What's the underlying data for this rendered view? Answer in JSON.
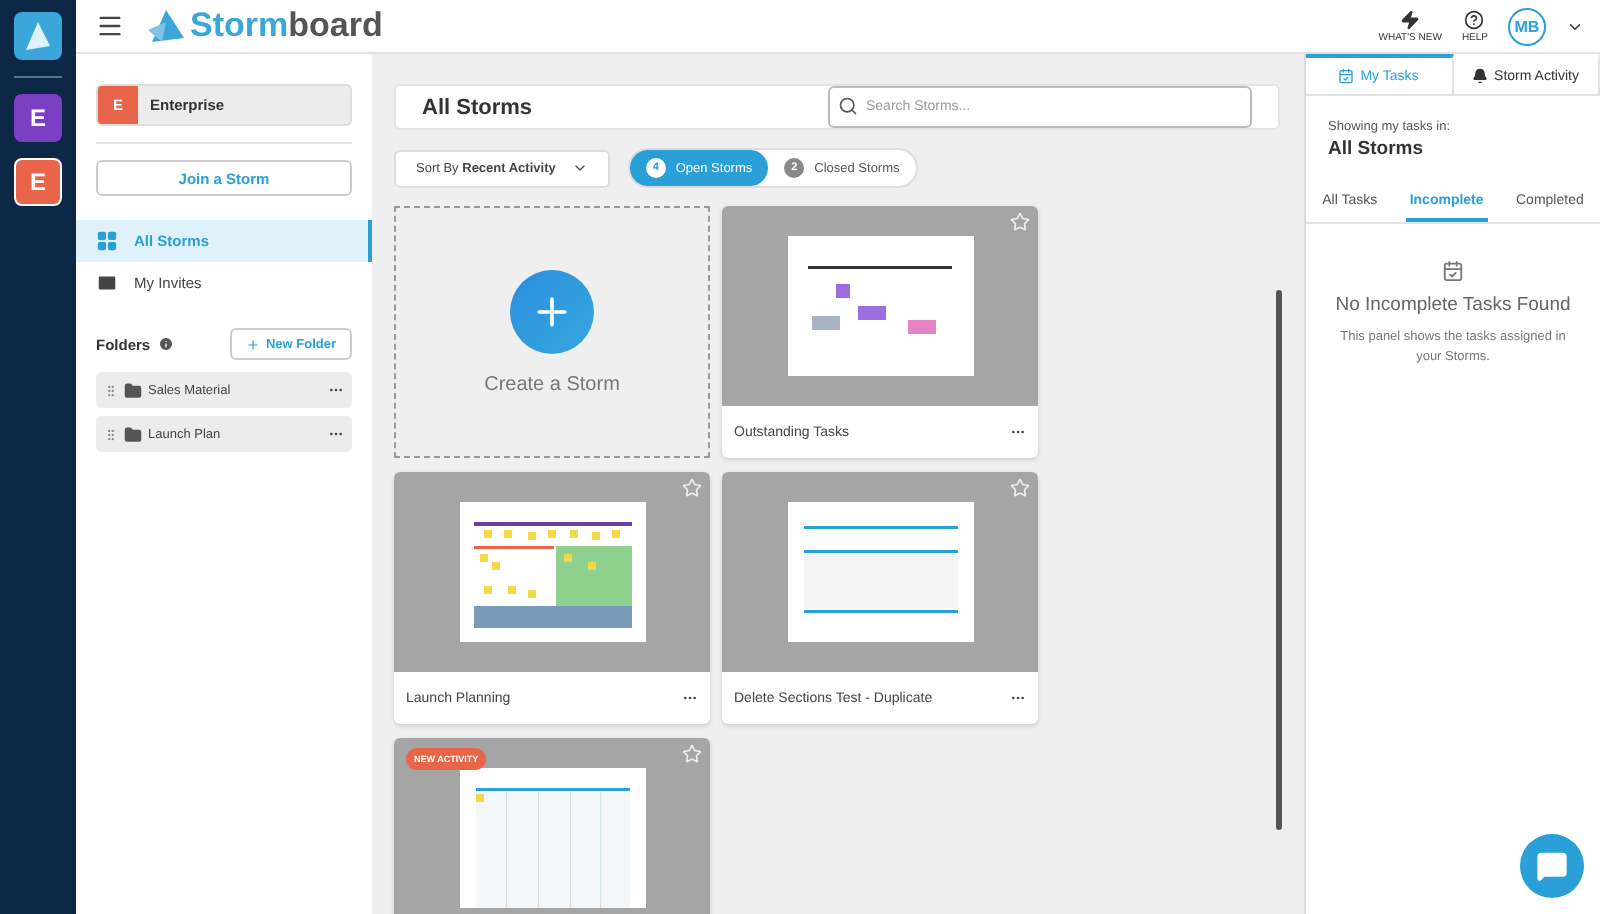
{
  "rail": {
    "workspaces": [
      {
        "letter": "E",
        "color": "#7b3fc4",
        "selected": false
      },
      {
        "letter": "E",
        "color": "#e8654a",
        "selected": true
      }
    ]
  },
  "topbar": {
    "logo": {
      "part_1": "Storm",
      "part_2": "board"
    },
    "actions": [
      {
        "kind": "bolt",
        "label": "WHAT'S NEW"
      },
      {
        "kind": "help",
        "label": "HELP"
      }
    ],
    "user_initials": "MB"
  },
  "sidebar": {
    "team": {
      "letter": "E",
      "name": "Enterprise"
    },
    "join_button": "Join a Storm",
    "nav": [
      {
        "kind": "grid",
        "label": "All Storms",
        "selected": true
      },
      {
        "kind": "mail",
        "label": "My Invites",
        "selected": false
      }
    ],
    "folders_title": "Folders",
    "new_folder_button": "New Folder",
    "folders": [
      "Sales Material",
      "Launch Plan"
    ]
  },
  "main": {
    "title": "All Storms",
    "search": {
      "placeholder": "Search Storms..."
    },
    "sort": {
      "prefix": "Sort By",
      "value": "Recent Activity"
    },
    "filters": [
      {
        "count": "4",
        "label": "Open Storms",
        "selected": true
      },
      {
        "count": "2",
        "label": "Closed Storms",
        "selected": false
      }
    ],
    "create_label": "Create a Storm",
    "storms": [
      {
        "kind": "notes",
        "name": "Outstanding Tasks"
      },
      {
        "kind": "planning",
        "name": "Launch Planning"
      },
      {
        "kind": "sections",
        "name": "Delete Sections Test - Duplicate"
      },
      {
        "kind": "columns",
        "badge": "NEW ACTIVITY"
      }
    ]
  },
  "tasks_panel": {
    "tabs": [
      {
        "kind": "calendar",
        "label": "My Tasks",
        "selected": true
      },
      {
        "kind": "bell",
        "label": "Storm Activity",
        "selected": false
      }
    ],
    "showing_label": "Showing my tasks in:",
    "scope": "All Storms",
    "filters": [
      {
        "label": "All Tasks",
        "selected": false
      },
      {
        "label": "Incomplete",
        "selected": true
      },
      {
        "label": "Completed",
        "selected": false
      }
    ],
    "empty_title": "No Incomplete Tasks Found",
    "empty_text": "This panel shows the tasks assigned in your Storms."
  }
}
